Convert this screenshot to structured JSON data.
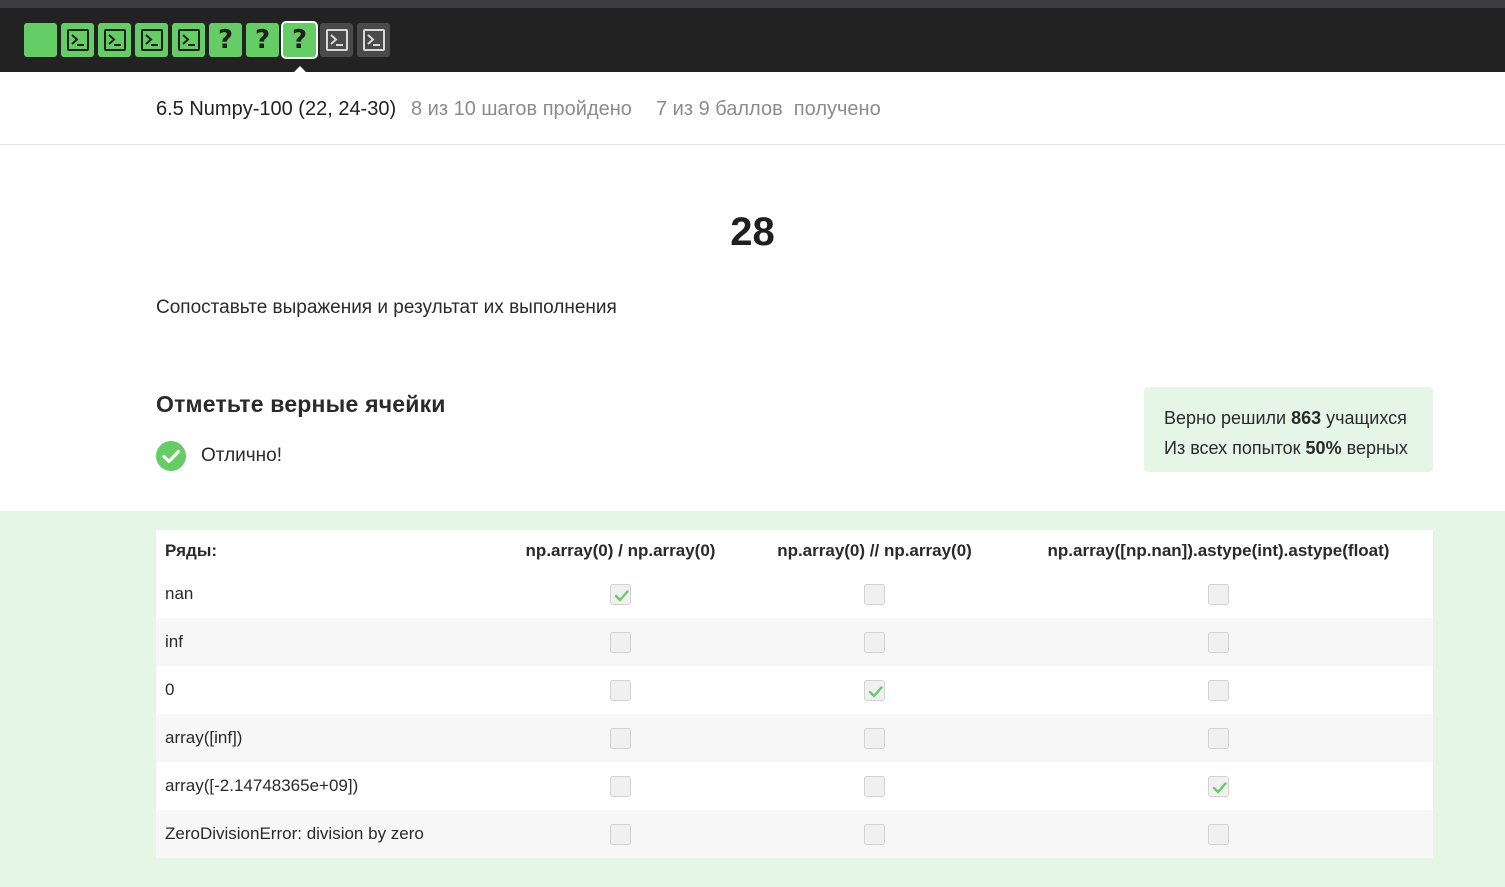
{
  "stepbar": {
    "steps": [
      {
        "kind": "blank",
        "state": "done",
        "icon": "blank-step-icon"
      },
      {
        "kind": "code",
        "state": "done",
        "icon": "terminal-icon"
      },
      {
        "kind": "code",
        "state": "done",
        "icon": "terminal-icon"
      },
      {
        "kind": "code",
        "state": "done",
        "icon": "terminal-icon"
      },
      {
        "kind": "code",
        "state": "done",
        "icon": "terminal-icon"
      },
      {
        "kind": "quiz",
        "state": "done",
        "icon": "question-icon",
        "glyph": "?"
      },
      {
        "kind": "quiz",
        "state": "done",
        "icon": "question-icon",
        "glyph": "?"
      },
      {
        "kind": "quiz",
        "state": "done",
        "current": true,
        "icon": "question-icon",
        "glyph": "?"
      },
      {
        "kind": "code",
        "state": "todo",
        "icon": "terminal-icon"
      },
      {
        "kind": "code",
        "state": "todo",
        "icon": "terminal-icon"
      }
    ],
    "colors": {
      "done": "#66cc66",
      "todo": "#4a4a4a",
      "bar": "#222222"
    }
  },
  "lesson": {
    "title": "6.5 Numpy-100 (22, 24-30)",
    "progress": "8 из 10 шагов пройдено",
    "score": "7 из 9 баллов  получено"
  },
  "step": {
    "number": "28",
    "task": "Сопоставьте выражения и результат их выполнения",
    "section_title": "Отметьте верные ячейки",
    "status_text": "Отлично!",
    "status_icon": "check-circle-icon"
  },
  "stats": {
    "line1_prefix": "Верно решили ",
    "line1_value": "863",
    "line1_suffix": " учащихся",
    "line2_prefix": "Из всех попыток ",
    "line2_value": "50%",
    "line2_suffix": " верных"
  },
  "matrix": {
    "row_header": "Ряды:",
    "columns": [
      "np.array(0) / np.array(0)",
      "np.array(0) // np.array(0)",
      "np.array([np.nan]).astype(int).astype(float)"
    ],
    "rows": [
      {
        "label": "nan",
        "checked": [
          true,
          false,
          false
        ]
      },
      {
        "label": "inf",
        "checked": [
          false,
          false,
          false
        ]
      },
      {
        "label": "0",
        "checked": [
          false,
          true,
          false
        ]
      },
      {
        "label": "array([inf])",
        "checked": [
          false,
          false,
          false
        ]
      },
      {
        "label": "array([-2.14748365e+09])",
        "checked": [
          false,
          false,
          true
        ]
      },
      {
        "label": "ZeroDivisionError: division by zero",
        "checked": [
          false,
          false,
          false
        ]
      }
    ]
  },
  "colors": {
    "accent": "#66cc66",
    "panel_bg": "#e6f6e6"
  }
}
